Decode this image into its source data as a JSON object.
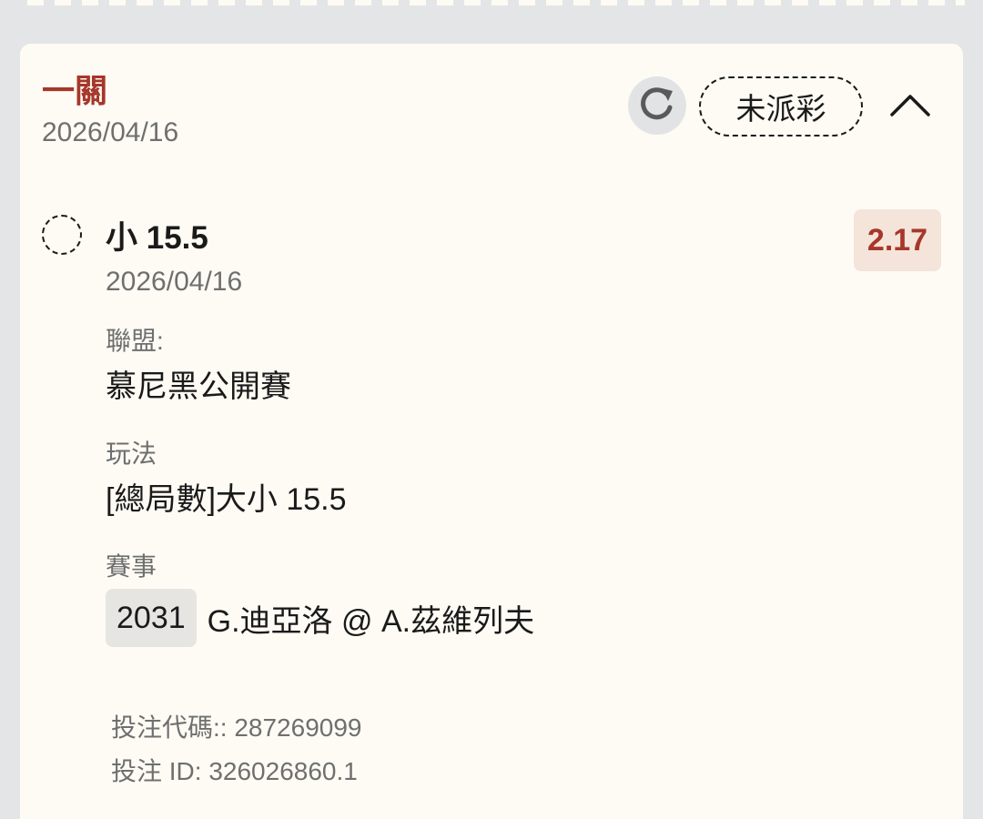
{
  "leg": {
    "title": "一關",
    "date": "2026/04/16",
    "status": "未派彩",
    "icons": {
      "refresh": "refresh-icon",
      "collapse": "chevron-up-icon",
      "result": "pending-dashed-circle-icon"
    }
  },
  "selection": {
    "name": "小 15.5",
    "date": "2026/04/16",
    "odds": "2.17"
  },
  "details": {
    "league_label": "聯盟:",
    "league_value": "慕尼黑公開賽",
    "market_label": "玩法",
    "market_value": "[總局數]大小 15.5",
    "event_label": "賽事",
    "event_id": "2031",
    "event_name": "G.迪亞洛 @ A.茲維列夫"
  },
  "meta": {
    "bet_code": "投注代碼:: 287269099",
    "bet_id": "投注 ID: 326026860.1"
  },
  "colors": {
    "accent": "#a6372a",
    "card_bg": "#fdfbf4",
    "page_bg": "#e4e5e7",
    "odds_bg": "#f4e4da"
  }
}
